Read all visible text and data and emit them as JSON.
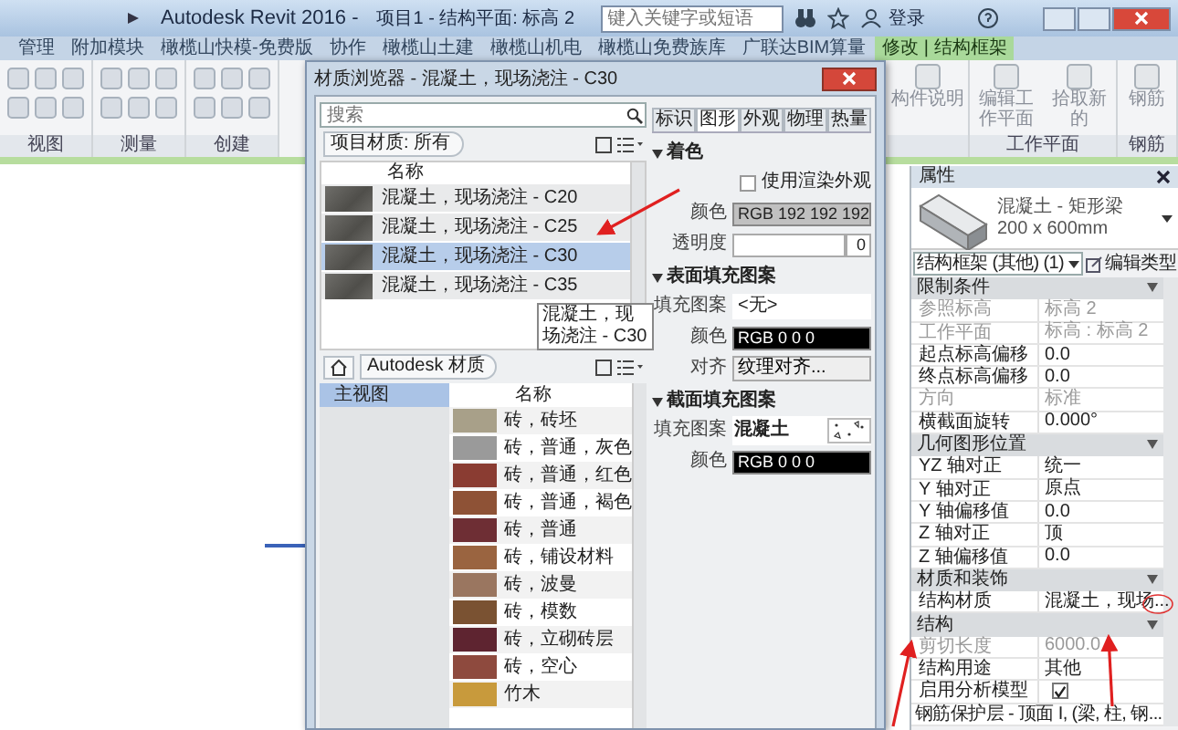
{
  "app_window": {
    "title": "Autodesk Revit 2016 -",
    "document": "项目1 - 结构平面: 标高 2",
    "search": {
      "placeholder": "键入关键字或短语"
    },
    "user": "登录"
  },
  "ribbon_tabs": [
    {
      "label": "管理",
      "selected": false
    },
    {
      "label": "附加模块",
      "selected": false
    },
    {
      "label": "橄榄山快模-免费版",
      "selected": false
    },
    {
      "label": "协作",
      "selected": false
    },
    {
      "label": "橄榄山土建",
      "selected": false
    },
    {
      "label": "橄榄山机电",
      "selected": false
    },
    {
      "label": "橄榄山免费族库",
      "selected": false
    },
    {
      "label": "广联达BIM算量",
      "selected": false
    },
    {
      "label": "修改 | 结构框架",
      "selected": true
    }
  ],
  "ribbon_panels_left": [
    {
      "label": "视图"
    },
    {
      "label": "测量"
    },
    {
      "label": "创建"
    }
  ],
  "ribbon_panels_right": [
    {
      "tools": [
        "构件说明"
      ]
    },
    {
      "label": "工作平面",
      "tools": [
        "编辑工作平面",
        "拾取新的"
      ]
    },
    {
      "label": "钢筋",
      "tools": [
        "钢筋"
      ]
    }
  ],
  "material_browser": {
    "title": "材质浏览器 - 混凝土，现场浇注 - C30",
    "search": {
      "placeholder": "搜索"
    },
    "project_filter": "项目材质: 所有",
    "project_list": {
      "header": "名称",
      "items": [
        {
          "name": "混凝土，现场浇注 - C20",
          "selected": false
        },
        {
          "name": "混凝土，现场浇注 - C25",
          "selected": false
        },
        {
          "name": "混凝土，现场浇注 - C30",
          "selected": true
        },
        {
          "name": "混凝土，现场浇注 - C35",
          "selected": false
        }
      ]
    },
    "tooltip": "混凝土，现场浇注 - C30",
    "library_name": "Autodesk 材质",
    "library_tree": [
      {
        "label": "主视图",
        "selected": true
      }
    ],
    "library_list": {
      "header": "名称",
      "items": [
        {
          "name": "砖，砖坯",
          "color": "#a8a089"
        },
        {
          "name": "砖，普通，灰色",
          "color": "#9a9a9a"
        },
        {
          "name": "砖，普通，红色",
          "color": "#8a3c32"
        },
        {
          "name": "砖，普通，褐色",
          "color": "#8e5236"
        },
        {
          "name": "砖，普通",
          "color": "#6e2e34"
        },
        {
          "name": "砖，铺设材料",
          "color": "#9a6440"
        },
        {
          "name": "砖，波曼",
          "color": "#9a7660"
        },
        {
          "name": "砖，模数",
          "color": "#7a5232"
        },
        {
          "name": "砖，立砌砖层",
          "color": "#5e2430"
        },
        {
          "name": "砖，空心",
          "color": "#8e4a3e"
        },
        {
          "name": "竹木",
          "color": "#c89a3c"
        }
      ]
    },
    "tabs": [
      {
        "label": "标识",
        "selected": false
      },
      {
        "label": "图形",
        "selected": true
      },
      {
        "label": "外观",
        "selected": false
      },
      {
        "label": "物理",
        "selected": false
      },
      {
        "label": "热量",
        "selected": false
      }
    ],
    "shading": {
      "heading": "着色",
      "use_render": {
        "label": "使用渲染外观",
        "checked": false
      },
      "color_label": "颜色",
      "color_value": "RGB 192 192 192",
      "color": "#c0c0c0",
      "transparency_label": "透明度",
      "transparency_value": "0"
    },
    "surface_pattern": {
      "heading": "表面填充图案",
      "pattern_label": "填充图案",
      "pattern_value": "<无>",
      "color_label": "颜色",
      "color_value": "RGB 0 0 0",
      "color": "#000000",
      "align_label": "对齐",
      "align_button": "纹理对齐..."
    },
    "cut_pattern": {
      "heading": "截面填充图案",
      "pattern_label": "填充图案",
      "pattern_value": "混凝土",
      "color_label": "颜色",
      "color_value": "RGB 0 0 0",
      "color": "#000000"
    }
  },
  "properties": {
    "title": "属性",
    "type_name": "混凝土 - 矩形梁",
    "type_size": "200 x 600mm",
    "selector": "结构框架 (其他) (1)",
    "edit_type": "编辑类型",
    "groups": [
      {
        "heading": "限制条件",
        "rows": [
          {
            "kind": "text",
            "name": "参照标高",
            "value": "标高 2",
            "disabled": true
          },
          {
            "kind": "text",
            "name": "工作平面",
            "value": "标高 : 标高 2",
            "disabled": true
          },
          {
            "kind": "text",
            "name": "起点标高偏移",
            "value": "0.0",
            "disabled": false
          },
          {
            "kind": "text",
            "name": "终点标高偏移",
            "value": "0.0",
            "disabled": false
          },
          {
            "kind": "text",
            "name": "方向",
            "value": "标准",
            "disabled": true
          },
          {
            "kind": "text",
            "name": "横截面旋转",
            "value": "0.000°",
            "disabled": false
          }
        ]
      },
      {
        "heading": "几何图形位置",
        "rows": [
          {
            "kind": "text",
            "name": "YZ 轴对正",
            "value": "统一",
            "disabled": false
          },
          {
            "kind": "text",
            "name": "Y 轴对正",
            "value": "原点",
            "disabled": false
          },
          {
            "kind": "text",
            "name": "Y 轴偏移值",
            "value": "0.0",
            "disabled": false
          },
          {
            "kind": "text",
            "name": "Z 轴对正",
            "value": "顶",
            "disabled": false
          },
          {
            "kind": "text",
            "name": "Z 轴偏移值",
            "value": "0.0",
            "disabled": false
          }
        ]
      },
      {
        "heading": "材质和装饰",
        "rows": [
          {
            "kind": "text",
            "name": "结构材质",
            "value": "混凝土，现场...",
            "disabled": false
          }
        ]
      },
      {
        "heading": "结构",
        "rows": [
          {
            "kind": "text",
            "name": "剪切长度",
            "value": "6000.0",
            "disabled": true
          },
          {
            "kind": "text",
            "name": "结构用途",
            "value": "其他",
            "disabled": false
          },
          {
            "kind": "check",
            "name": "启用分析模型",
            "checked": true,
            "disabled": false
          },
          {
            "kind": "wide",
            "name": "钢筋保护层 - 顶面 I, (梁, 柱, 钢...",
            "disabled": false
          }
        ]
      }
    ]
  }
}
